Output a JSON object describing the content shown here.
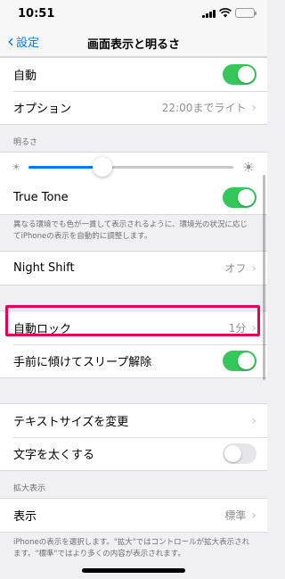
{
  "status_bar": {
    "time": "10:51"
  },
  "nav": {
    "back_label": "設定",
    "title": "画面表示と明るさ"
  },
  "auto_section": {
    "auto_label": "自動",
    "auto_on": true,
    "option_label": "オプション",
    "option_value": "22:00までライト"
  },
  "brightness_section": {
    "header": "明るさ",
    "level": 0.36,
    "true_tone_label": "True Tone",
    "true_tone_on": true,
    "footer": "異なる環境でも色が一貫して表示されるように、環境光の状況に応じてiPhoneの表示を自動的に調整します。"
  },
  "night_shift": {
    "label": "Night Shift",
    "value": "オフ"
  },
  "lock_section": {
    "auto_lock_label": "自動ロック",
    "auto_lock_value": "1分",
    "raise_to_wake_label": "手前に傾けてスリープ解除",
    "raise_to_wake_on": true
  },
  "text_section": {
    "text_size_label": "テキストサイズを変更",
    "bold_text_label": "文字を太くする",
    "bold_text_on": false
  },
  "zoom_section": {
    "header": "拡大表示",
    "view_label": "表示",
    "view_value": "標準",
    "footer": "iPhoneの表示を選択します。\"拡大\"ではコントロールが拡大表示されます。\"標準\"ではより多くの内容が表示されます。"
  },
  "colors": {
    "accent": "#007aff",
    "toggle_on": "#34c759",
    "highlight": "#e6005e"
  }
}
